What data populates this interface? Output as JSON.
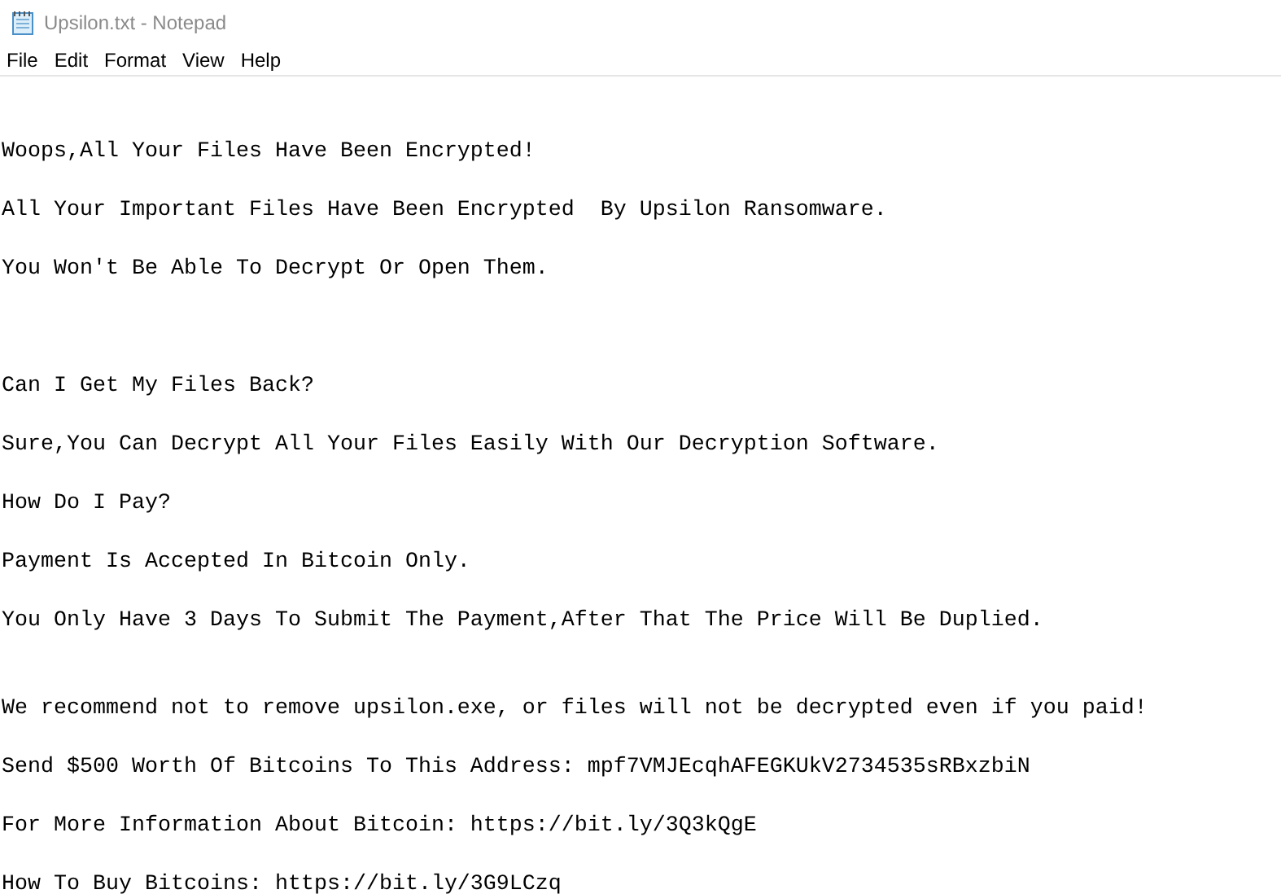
{
  "window": {
    "title": "Upsilon.txt - Notepad"
  },
  "menu": [
    "File",
    "Edit",
    "Format",
    "View",
    "Help"
  ],
  "document": {
    "blocks": [
      {
        "lines": [
          "Woops,All Your Files Have Been Encrypted!",
          "All Your Important Files Have Been Encrypted  By Upsilon Ransomware.",
          "You Won't Be Able To Decrypt Or Open Them."
        ]
      },
      {
        "lines": [
          "Can I Get My Files Back?",
          "Sure,You Can Decrypt All Your Files Easily With Our Decryption Software.",
          "How Do I Pay?",
          "Payment Is Accepted In Bitcoin Only.",
          "You Only Have 3 Days To Submit The Payment,After That The Price Will Be Duplied."
        ]
      },
      {
        "lines": [
          "We recommend not to remove upsilon.exe, or files will not be decrypted even if you paid!",
          "Send $500 Worth Of Bitcoins To This Address: mpf7VMJEcqhAFEGKUkV2734535sRBxzbiN",
          "For More Information About Bitcoin: https://bit.ly/3Q3kQgE",
          "How To Buy Bitcoins: https://bit.ly/3G9LCzq"
        ]
      }
    ]
  }
}
